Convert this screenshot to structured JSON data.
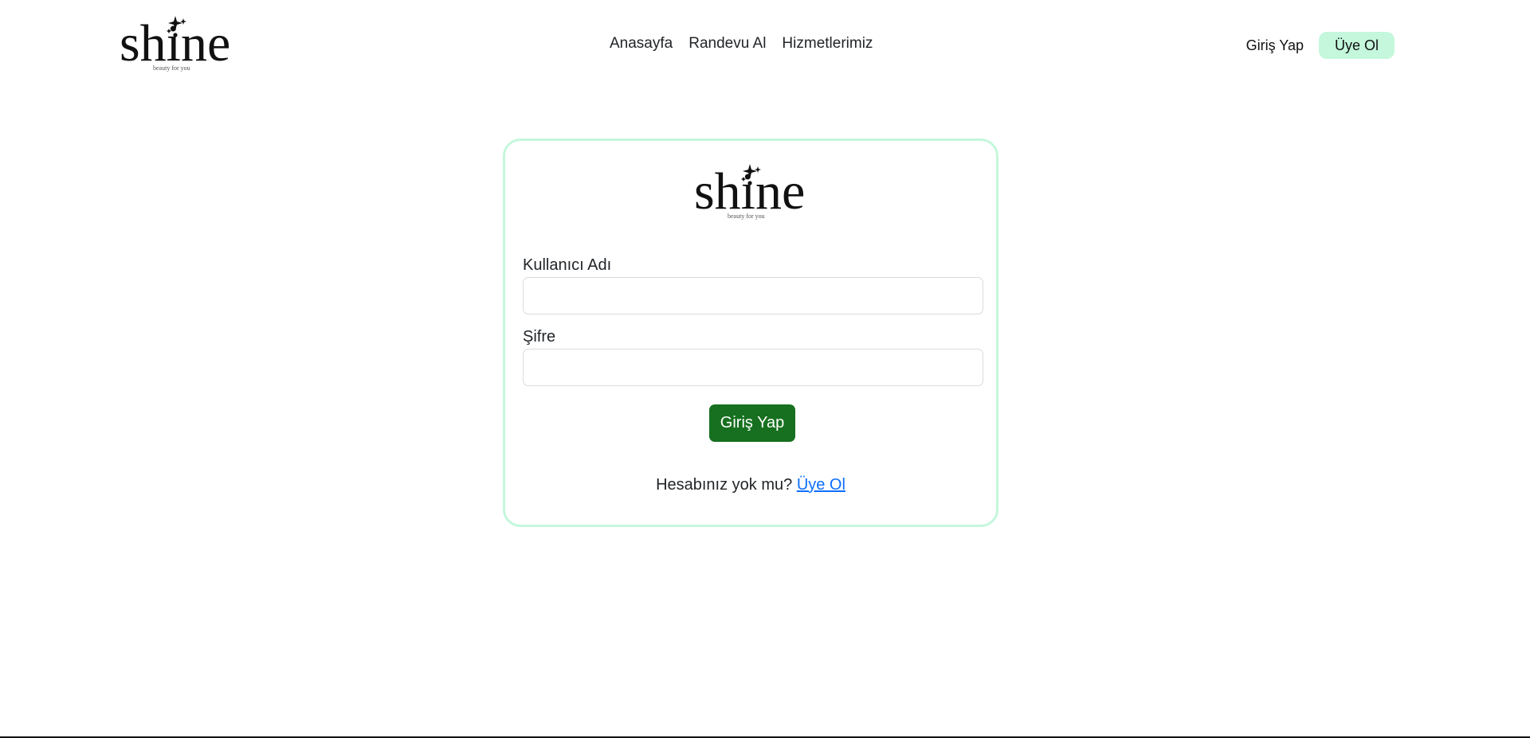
{
  "brand": {
    "name": "shine",
    "tagline": "beauty for you"
  },
  "nav": {
    "items": [
      {
        "label": "Anasayfa"
      },
      {
        "label": "Randevu Al"
      },
      {
        "label": "Hizmetlerimiz"
      }
    ]
  },
  "auth": {
    "login_label": "Giriş Yap",
    "signup_label": "Üye Ol"
  },
  "form": {
    "username_label": "Kullanıcı Adı",
    "username_value": "",
    "password_label": "Şifre",
    "password_value": "",
    "submit_label": "Giriş Yap",
    "no_account_text": "Hesabınız yok mu?",
    "signup_link_label": "Üye Ol"
  },
  "colors": {
    "accent_mint": "#c4f7dc",
    "submit_green": "#16701f",
    "link_blue": "#0d6efd"
  }
}
